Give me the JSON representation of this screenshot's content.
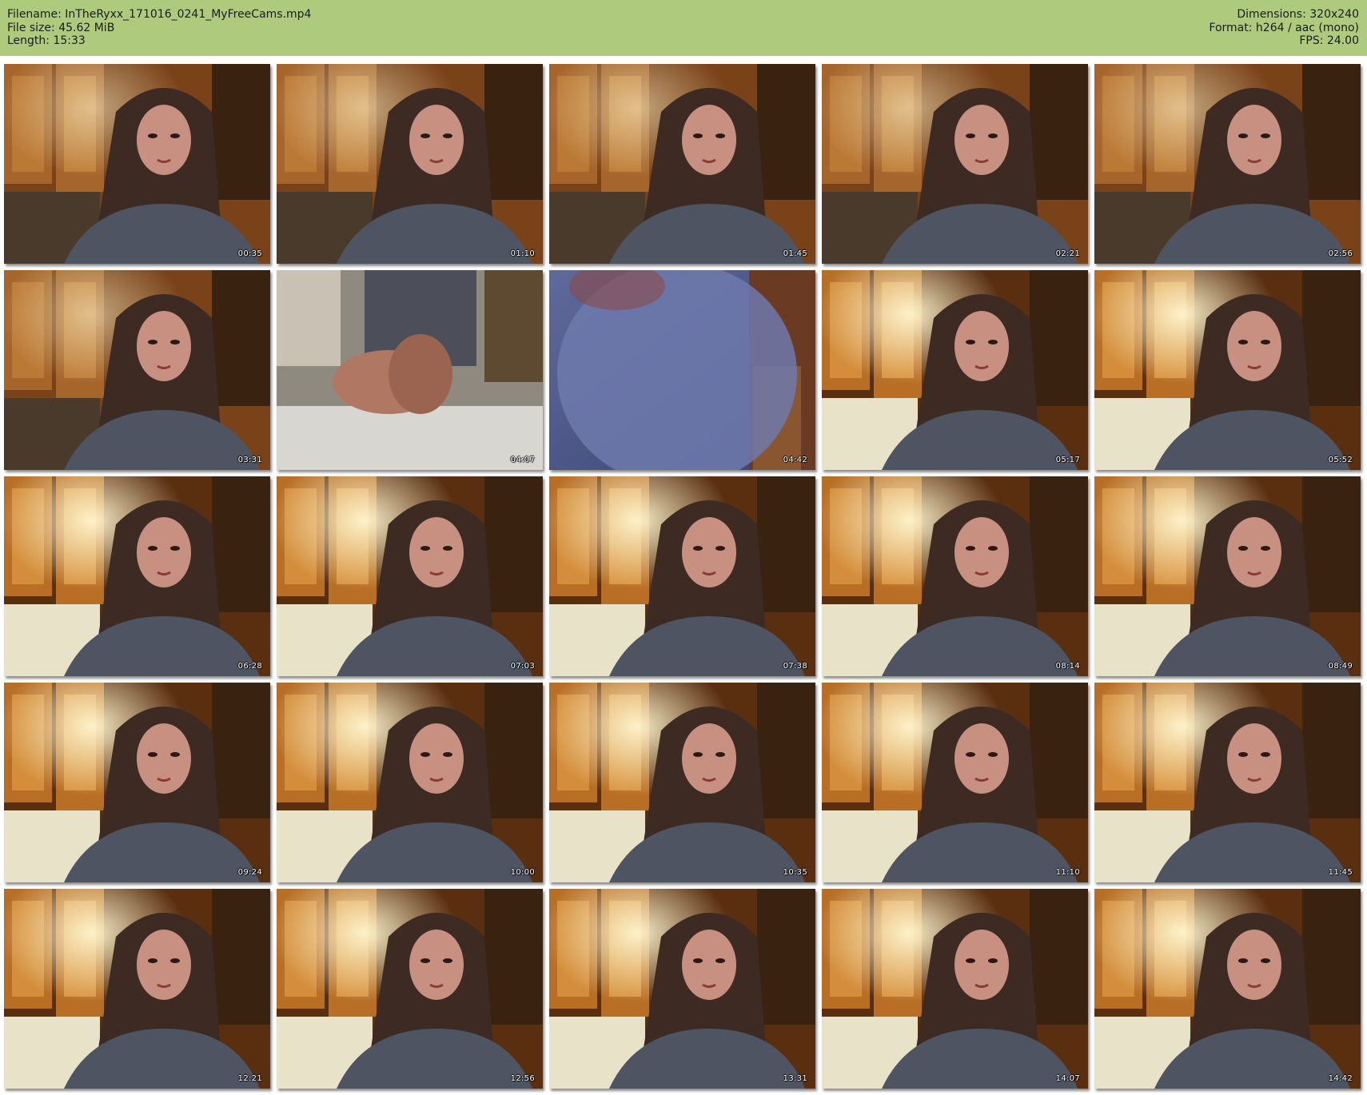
{
  "meta": {
    "filename_line": "Filename: InTheRyxx_171016_0241_MyFreeCams.mp4",
    "filesize_line": "File size: 45.62 MiB",
    "length_line": "Length: 15:33",
    "dimensions_line": "Dimensions: 320x240",
    "format_line": "Format: h264 / aac (mono)",
    "fps_line": "FPS: 24.00"
  },
  "colors": {
    "header_bg": "#aecb7d",
    "background": "#ffffff",
    "timestamp_text": "#ffffff"
  },
  "thumbnails": [
    {
      "time": "00:35"
    },
    {
      "time": "01:10"
    },
    {
      "time": "01:45"
    },
    {
      "time": "02:21"
    },
    {
      "time": "02:56"
    },
    {
      "time": "03:31"
    },
    {
      "time": "04:07"
    },
    {
      "time": "04:42"
    },
    {
      "time": "05:17"
    },
    {
      "time": "05:52"
    },
    {
      "time": "06:28"
    },
    {
      "time": "07:03"
    },
    {
      "time": "07:38"
    },
    {
      "time": "08:14"
    },
    {
      "time": "08:49"
    },
    {
      "time": "09:24"
    },
    {
      "time": "10:00"
    },
    {
      "time": "10:35"
    },
    {
      "time": "11:10"
    },
    {
      "time": "11:45"
    },
    {
      "time": "12:21"
    },
    {
      "time": "12:56"
    },
    {
      "time": "13:31"
    },
    {
      "time": "14:07"
    },
    {
      "time": "14:42"
    }
  ]
}
